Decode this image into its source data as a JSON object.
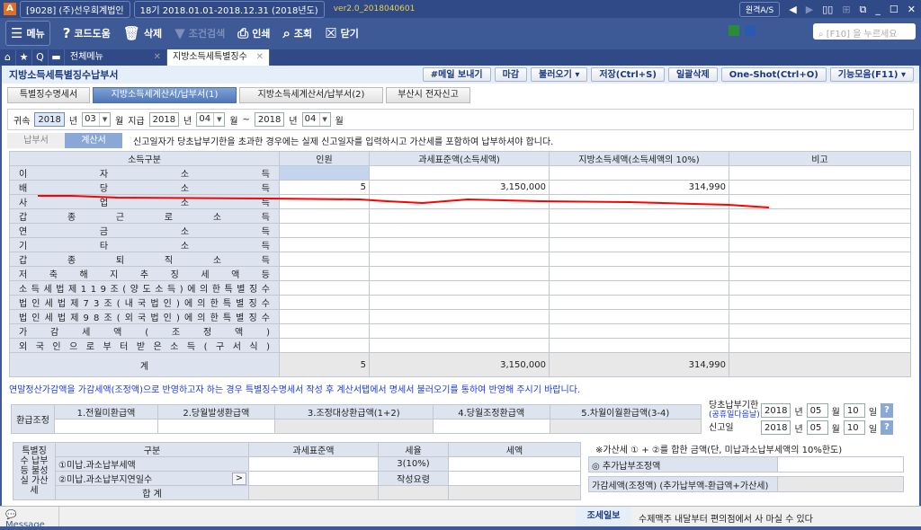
{
  "titlebar": {
    "company": "[9028] (주)선우회계법인",
    "period": "18기 2018.01.01-2018.12.31 (2018년도)",
    "version": "ver2.0_2018040601",
    "remote": "원격A/S"
  },
  "toolbar": {
    "menu": "메뉴",
    "help": "코드도움",
    "delete": "삭제",
    "filter": "조건검색",
    "print": "인쇄",
    "inquiry": "조회",
    "close": "닫기",
    "search_placeholder": "[F10] 을 누르세요"
  },
  "tabs": {
    "all_menu": "전체메뉴",
    "current": "지방소득세특별징수"
  },
  "page": {
    "title": "지방소득세특별징수납부서",
    "buttons": [
      "#메일 보내기",
      "마감",
      "불러오기 ▾",
      "저장(Ctrl+S)",
      "일괄삭제",
      "One-Shot(Ctrl+O)",
      "기능모음(F11) ▾"
    ],
    "subtabs": [
      "특별징수명세서",
      "지방소득세계산서/납부서(1)",
      "지방소득세계산서/납부서(2)",
      "부산시 전자신고"
    ]
  },
  "filter": {
    "attr_label": "귀속",
    "attr_year": "2018",
    "year_unit": "년",
    "attr_month": "03",
    "month_unit": "월",
    "pay_label": "지급",
    "from_year": "2018",
    "from_month": "04",
    "tilde": "~",
    "to_year": "2018",
    "to_month": "04"
  },
  "kind": {
    "pay": "납부서",
    "calc": "계산서",
    "notice": "신고일자가 당초납부기한을 초과한 경우에는 실제 신고일자를 입력하시고 가산세를 포함하여 납부하셔야 합니다."
  },
  "main_table": {
    "headers": [
      "소득구분",
      "인원",
      "과세표준액(소득세액)",
      "지방소득세액(소득세액의 10%)",
      "비고"
    ],
    "rows": [
      {
        "label": "이 자 소 득",
        "count": "",
        "base": "",
        "tax": ""
      },
      {
        "label": "배 당 소 득",
        "count": "5",
        "base": "3,150,000",
        "tax": "314,990"
      },
      {
        "label": "사 업 소 득",
        "count": "",
        "base": "",
        "tax": ""
      },
      {
        "label": "갑 종 근 로 소 득",
        "count": "",
        "base": "",
        "tax": ""
      },
      {
        "label": "연 금 소 득",
        "count": "",
        "base": "",
        "tax": ""
      },
      {
        "label": "기 타 소 득",
        "count": "",
        "base": "",
        "tax": ""
      },
      {
        "label": "갑 종 퇴 직 소 득",
        "count": "",
        "base": "",
        "tax": ""
      },
      {
        "label": "저 축 해 지 추 징 세 액 등",
        "count": "",
        "base": "",
        "tax": ""
      },
      {
        "label": "소 득 세 법 제 1 1 9 조 ( 양 도 소 득 ) 에 의 한 특 별 징 수",
        "count": "",
        "base": "",
        "tax": ""
      },
      {
        "label": "법 인 세 법 제 7 3 조 ( 내 국 법 인 ) 에 의 한 특 별 징 수",
        "count": "",
        "base": "",
        "tax": ""
      },
      {
        "label": "법 인 세 법 제 9 8 조 ( 외 국 법 인 ) 에 의 한 특 별 징 수",
        "count": "",
        "base": "",
        "tax": ""
      },
      {
        "label": "가 감 세 액 ( 조 정 액 )",
        "count": "",
        "base": "",
        "tax": ""
      },
      {
        "label": "외 국 인 으 로 부 터 받 은 소 득 ( 구 서 식 )",
        "count": "",
        "base": "",
        "tax": ""
      }
    ],
    "total": {
      "label": "계",
      "count": "5",
      "base": "3,150,000",
      "tax": "314,990"
    }
  },
  "info_text": "연말정산가감액을 가감세액(조정액)으로 반영하고자 하는 경우 특별징수명세서 작성 후 계산서탭에서 명세서 불러오기를 통하여 반영해 주시기 바랍니다.",
  "refund": {
    "label": "환급조정",
    "headers": [
      "1.전월미환급액",
      "2.당월발생환급액",
      "3.조정대상환급액(1+2)",
      "4.당월조정환급액",
      "5.차월이월환급액(3-4)"
    ]
  },
  "dates": {
    "due_label": "당초납부기한",
    "due_sub": "(공휴일다음날)",
    "due_year": "2018",
    "due_month": "05",
    "due_day": "10",
    "report_label": "신고일",
    "rep_year": "2018",
    "rep_month": "05",
    "rep_day": "10",
    "year": "년",
    "month": "월",
    "day": "일",
    "help": "?"
  },
  "penalty": {
    "label": "특별징수 납부등 불성실 가산세",
    "headers": [
      "구분",
      "과세표준액",
      "세율",
      "세액"
    ],
    "row1": "①미납.과소납부세액",
    "rate1": "3(10%)",
    "row2": "②미납.과소납부지연일수",
    "rate2": "작성요령",
    "total": "합 계",
    "arrow": ">"
  },
  "side": {
    "note": "※가산세 ① + ②를 합한 금액(단, 미납과소납부세액의 10%한도)",
    "extra": "◎ 추가납부조정액",
    "adjust": "가감세액(조정액) (추가납부액-환급액+가산세)"
  },
  "footer": {
    "message": "Message",
    "tip_label": "조세일보",
    "tip": "수제맥주 내달부터 편의점에서 사 마실 수 있다"
  }
}
